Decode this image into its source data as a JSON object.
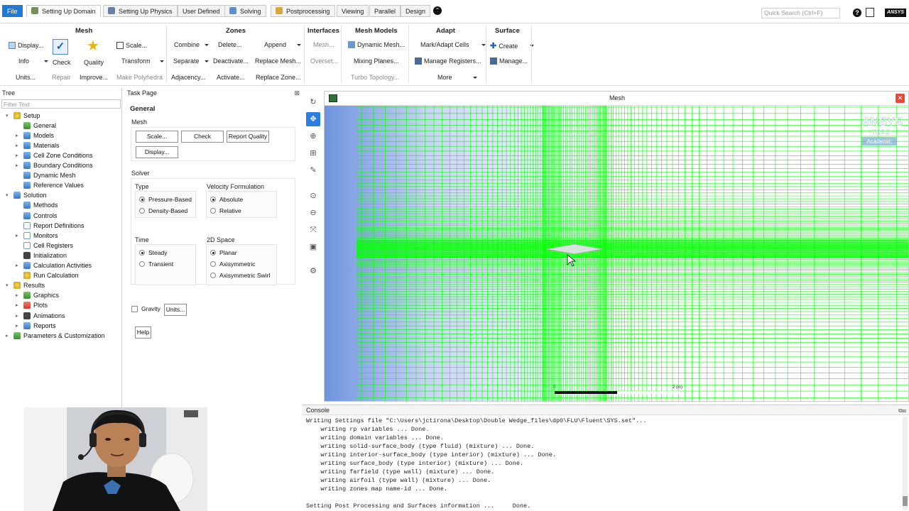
{
  "menubar": {
    "tabs": [
      {
        "label": "File",
        "icon": null
      },
      {
        "label": "Setting Up Domain",
        "icon": "setup-icon"
      },
      {
        "label": "Setting Up Physics",
        "icon": "physics-icon"
      },
      {
        "label": "User Defined",
        "icon": null
      },
      {
        "label": "Solving",
        "icon": "solving-icon"
      },
      {
        "label": "Postprocessing",
        "icon": "postprocessing-icon"
      },
      {
        "label": "Viewing",
        "icon": null
      },
      {
        "label": "Parallel",
        "icon": null
      },
      {
        "label": "Design",
        "icon": null
      }
    ],
    "quick_search_placeholder": "Quick Search (Ctrl+F)",
    "brand": "ANSYS"
  },
  "ribbon": {
    "mesh": {
      "title": "Mesh",
      "display": "Display...",
      "scale": "Scale...",
      "info": "Info",
      "check": "Check",
      "quality": "Quality",
      "transform": "Transform",
      "units": "Units...",
      "repair": "Repair",
      "improve": "Improve...",
      "make_polyhedra": "Make Polyhedra"
    },
    "zones": {
      "title": "Zones",
      "combine": "Combine",
      "delete": "Delete...",
      "append": "Append",
      "separate": "Separate",
      "deactivate": "Deactivate...",
      "replace_mesh": "Replace Mesh...",
      "adjacency": "Adjacency...",
      "activate": "Activate...",
      "replace_zone": "Replace Zone..."
    },
    "interfaces": {
      "title": "Interfaces",
      "mesh": "Mesh...",
      "overset": "Overset..."
    },
    "mesh_models": {
      "title": "Mesh Models",
      "dynamic_mesh": "Dynamic Mesh...",
      "mixing_planes": "Mixing Planes...",
      "turbo_topology": "Turbo Topology..."
    },
    "adapt": {
      "title": "Adapt",
      "mark_adapt": "Mark/Adapt Cells",
      "manage_registers": "Manage Registers...",
      "more": "More"
    },
    "surface": {
      "title": "Surface",
      "create": "Create",
      "manage": "Manage..."
    }
  },
  "tree": {
    "header": "Tree",
    "filter_placeholder": "Filter Text",
    "items": [
      {
        "label": "Setup",
        "level": 0,
        "twisty": "▾",
        "icon": "gold"
      },
      {
        "label": "General",
        "level": 1,
        "twisty": "",
        "icon": "green"
      },
      {
        "label": "Models",
        "level": 1,
        "twisty": "▸",
        "icon": "blue"
      },
      {
        "label": "Materials",
        "level": 1,
        "twisty": "▸",
        "icon": "blue"
      },
      {
        "label": "Cell Zone Conditions",
        "level": 1,
        "twisty": "▸",
        "icon": "blue"
      },
      {
        "label": "Boundary Conditions",
        "level": 1,
        "twisty": "▸",
        "icon": "blue"
      },
      {
        "label": "Dynamic Mesh",
        "level": 1,
        "twisty": "",
        "icon": "blue"
      },
      {
        "label": "Reference Values",
        "level": 1,
        "twisty": "",
        "icon": "blue"
      },
      {
        "label": "Solution",
        "level": 0,
        "twisty": "▾",
        "icon": "blue"
      },
      {
        "label": "Methods",
        "level": 1,
        "twisty": "",
        "icon": "blue"
      },
      {
        "label": "Controls",
        "level": 1,
        "twisty": "",
        "icon": "blue"
      },
      {
        "label": "Report Definitions",
        "level": 1,
        "twisty": "",
        "icon": "doc"
      },
      {
        "label": "Monitors",
        "level": 1,
        "twisty": "▸",
        "icon": "doc"
      },
      {
        "label": "Cell Registers",
        "level": 1,
        "twisty": "",
        "icon": "doc"
      },
      {
        "label": "Initialization",
        "level": 1,
        "twisty": "",
        "icon": "dark"
      },
      {
        "label": "Calculation Activities",
        "level": 1,
        "twisty": "▸",
        "icon": "blue"
      },
      {
        "label": "Run Calculation",
        "level": 1,
        "twisty": "",
        "icon": "gold"
      },
      {
        "label": "Results",
        "level": 0,
        "twisty": "▾",
        "icon": "gold"
      },
      {
        "label": "Graphics",
        "level": 1,
        "twisty": "▸",
        "icon": "green"
      },
      {
        "label": "Plots",
        "level": 1,
        "twisty": "▸",
        "icon": "red"
      },
      {
        "label": "Animations",
        "level": 1,
        "twisty": "▸",
        "icon": "dark"
      },
      {
        "label": "Reports",
        "level": 1,
        "twisty": "▸",
        "icon": "blue"
      },
      {
        "label": "Parameters & Customization",
        "level": 0,
        "twisty": "▸",
        "icon": "green"
      }
    ]
  },
  "taskpage": {
    "header": "Task Page",
    "title": "General",
    "mesh_label": "Mesh",
    "scale": "Scale...",
    "check": "Check",
    "report_quality": "Report Quality",
    "display": "Display...",
    "solver_label": "Solver",
    "type_label": "Type",
    "pressure_based": "Pressure-Based",
    "density_based": "Density-Based",
    "velocity_label": "Velocity Formulation",
    "absolute": "Absolute",
    "relative": "Relative",
    "time_label": "Time",
    "steady": "Steady",
    "transient": "Transient",
    "space_label": "2D Space",
    "planar": "Planar",
    "axisymmetric": "Axisymmetric",
    "axisymmetric_swirl": "Axisymmetric Swirl",
    "gravity": "Gravity",
    "units": "Units...",
    "help": "Help"
  },
  "graphics": {
    "title": "Mesh",
    "logo": "ANSYS",
    "version": "R19.2",
    "edition": "Academic",
    "scale_start": "0",
    "scale_end": "2 (m)",
    "mesh_color": "#00ff00"
  },
  "console": {
    "header": "Console",
    "lines": [
      "Writing Settings file \"C:\\Users\\jctirona\\Desktop\\Double Wedge_files\\dp0\\FLU\\Fluent\\SYS.set\"...",
      "    writing rp variables ... Done.",
      "    writing domain variables ... Done.",
      "    writing solid-surface_body (type fluid) (mixture) ... Done.",
      "    writing interior-surface_body (type interior) (mixture) ... Done.",
      "    writing surface_body (type interior) (mixture) ... Done.",
      "    writing farfield (type wall) (mixture) ... Done.",
      "    writing airfoil (type wall) (mixture) ... Done.",
      "    writing zones map name-id ... Done.",
      "",
      "Setting Post Processing and Surfaces information ...     Done."
    ]
  }
}
